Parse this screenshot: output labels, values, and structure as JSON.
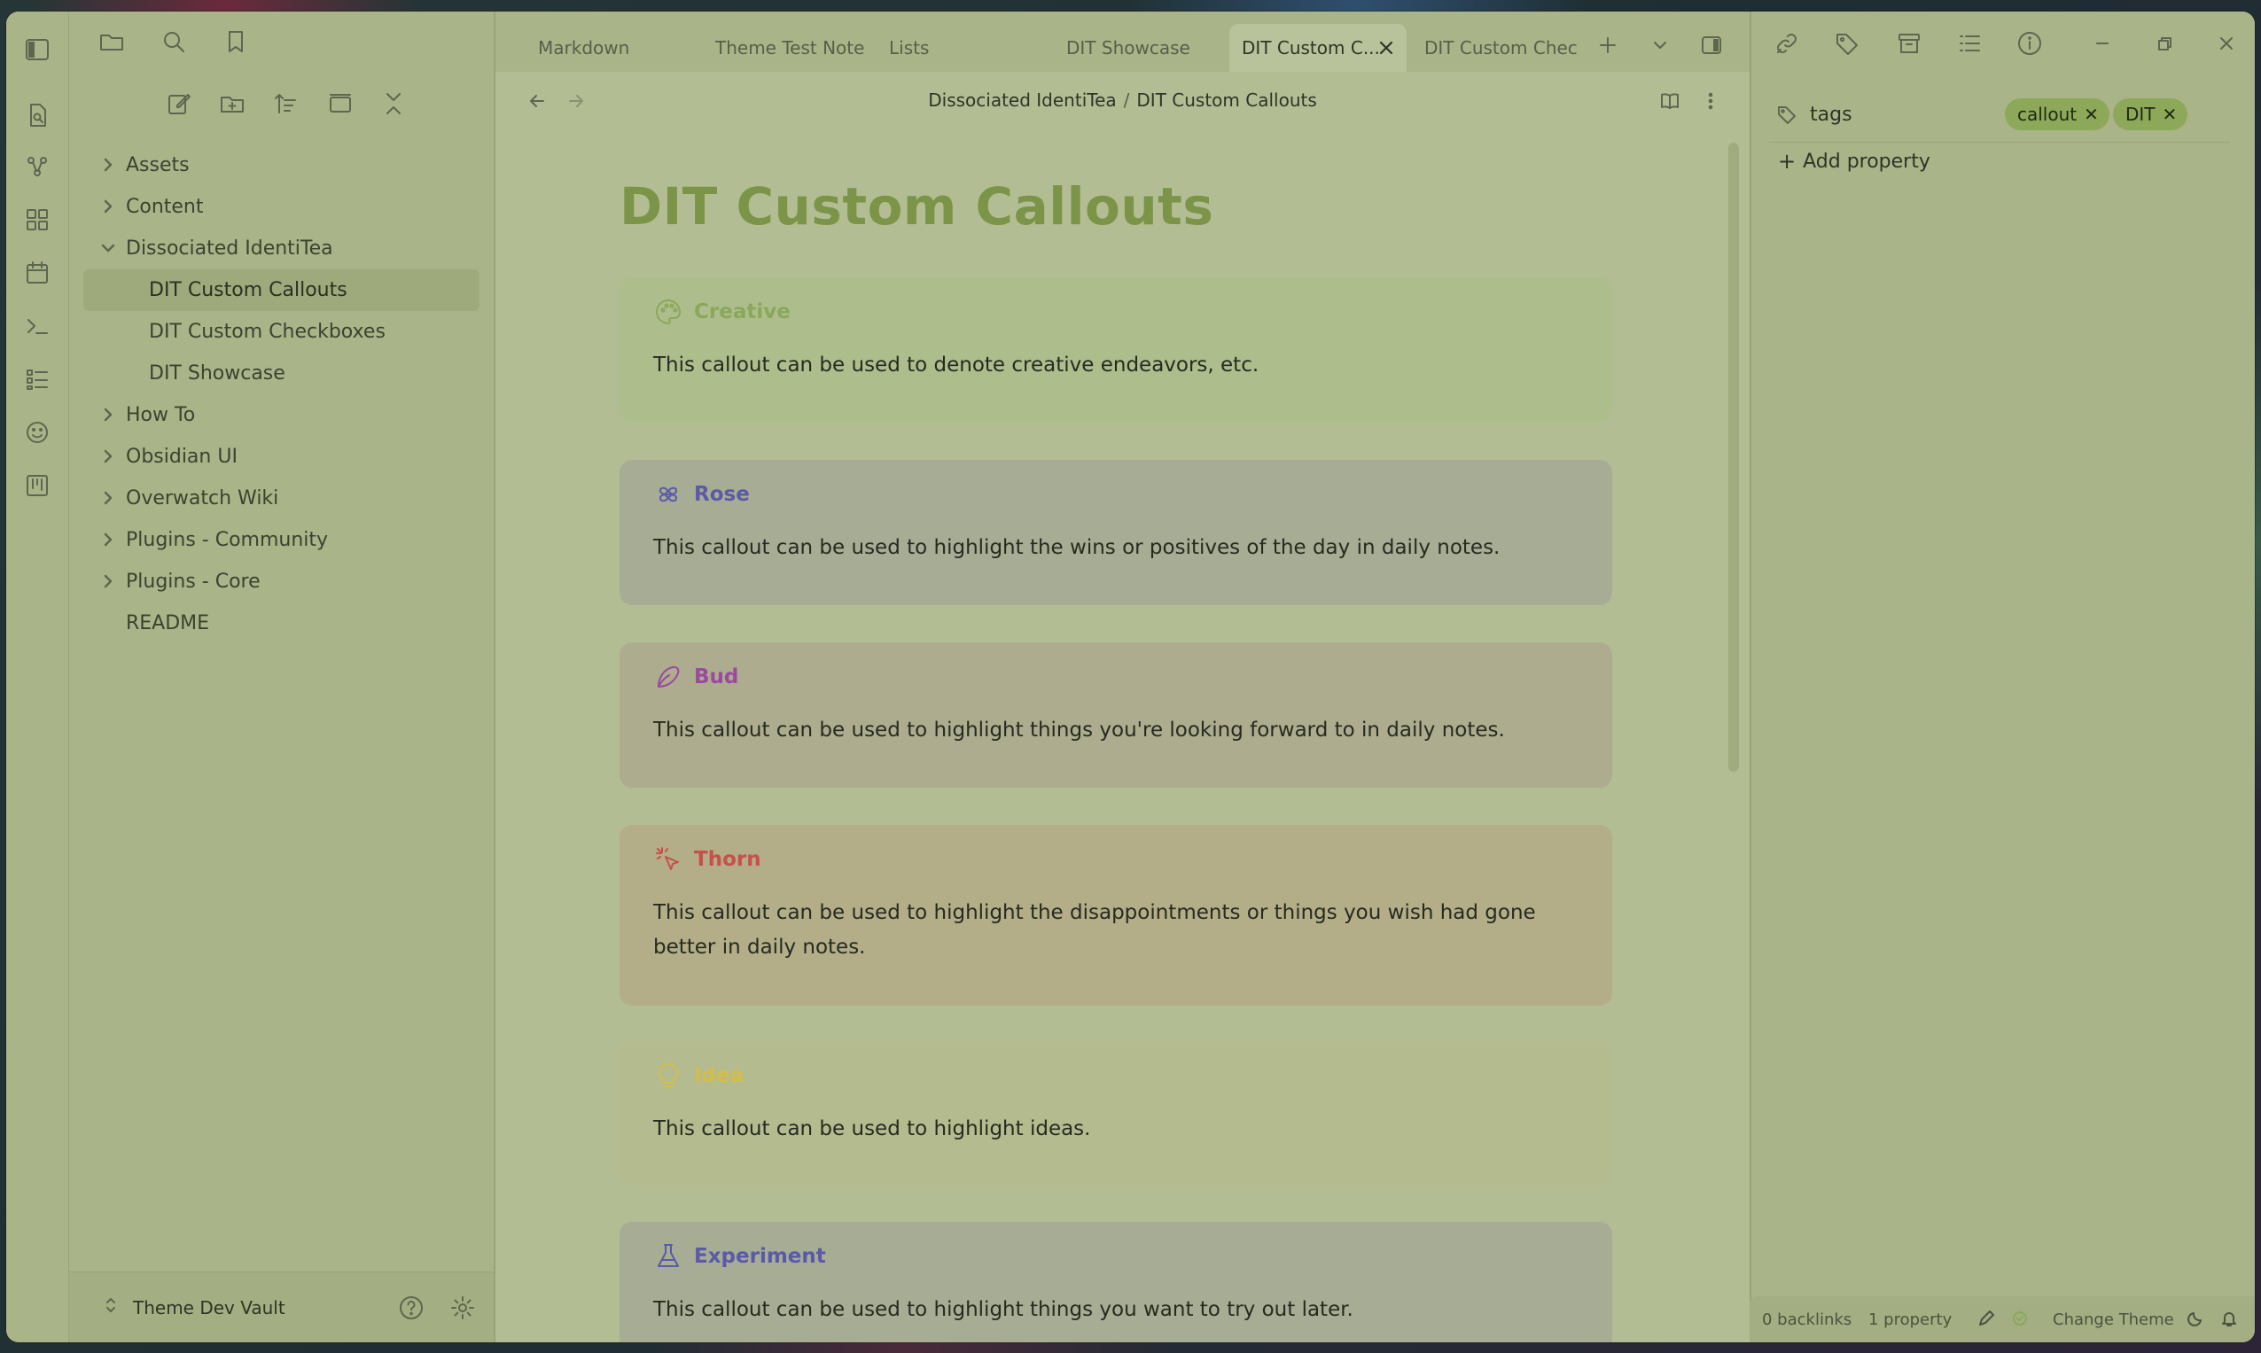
{
  "sidebar": {
    "tree": [
      {
        "label": "Assets",
        "type": "folder",
        "expanded": false
      },
      {
        "label": "Content",
        "type": "folder",
        "expanded": false
      },
      {
        "label": "Dissociated IdentiTea",
        "type": "folder",
        "expanded": true
      },
      {
        "label": "DIT Custom Callouts",
        "type": "child",
        "active": true
      },
      {
        "label": "DIT Custom Checkboxes",
        "type": "child"
      },
      {
        "label": "DIT Showcase",
        "type": "child"
      },
      {
        "label": "How To",
        "type": "folder",
        "expanded": false
      },
      {
        "label": "Obsidian UI",
        "type": "folder",
        "expanded": false
      },
      {
        "label": "Overwatch Wiki",
        "type": "folder",
        "expanded": false
      },
      {
        "label": "Plugins - Community",
        "type": "folder",
        "expanded": false
      },
      {
        "label": "Plugins - Core",
        "type": "folder",
        "expanded": false
      },
      {
        "label": "README",
        "type": "file"
      }
    ],
    "vault_name": "Theme Dev Vault"
  },
  "tabs": [
    {
      "label": "Markdown"
    },
    {
      "label": "Theme Test Note"
    },
    {
      "label": "Lists"
    },
    {
      "label": "DIT Showcase"
    },
    {
      "label": "DIT Custom C...",
      "active": true
    },
    {
      "label": "DIT Custom Chec..."
    }
  ],
  "main": {
    "breadcrumb": {
      "parent": "Dissociated IdentiTea",
      "separator": "/",
      "current": "DIT Custom Callouts"
    },
    "title": "DIT Custom Callouts",
    "callouts": [
      {
        "title": "Creative",
        "icon": "palette-icon",
        "body": "This callout can be used to denote creative endeavors, etc.",
        "bg": "#aebd8c",
        "accent": "#8aa85a"
      },
      {
        "title": "Rose",
        "icon": "flower-icon",
        "body": "This callout can be used to highlight the wins or positives of the day in daily notes.",
        "bg": "#a7ac94",
        "accent": "#5a5aa8"
      },
      {
        "title": "Bud",
        "icon": "bud-icon",
        "body": "This callout can be used to highlight things you're looking forward to in daily notes.",
        "bg": "#aeac8e",
        "accent": "#9a4aa0"
      },
      {
        "title": "Thorn",
        "icon": "sparkle-pointer-icon",
        "body": "This callout can be used to highlight the disappointments or things you wish had gone better in daily notes.",
        "bg": "#b3ad88",
        "accent": "#c8504a"
      },
      {
        "title": "Idea",
        "icon": "lightbulb-icon",
        "body": "This callout can be used to highlight ideas.",
        "bg": "#b4bb8f",
        "accent": "#d4bd4a"
      },
      {
        "title": "Experiment",
        "icon": "flask-icon",
        "body": "This callout can be used to highlight things you want to try out later.",
        "bg": "#a7ac94",
        "accent": "#5a5aa8"
      }
    ]
  },
  "properties": {
    "name": "tags",
    "tags": [
      "callout",
      "DIT"
    ],
    "add_label": "Add property"
  },
  "statusbar": {
    "backlinks": "0 backlinks",
    "properties": "1 property",
    "change_theme": "Change Theme"
  }
}
